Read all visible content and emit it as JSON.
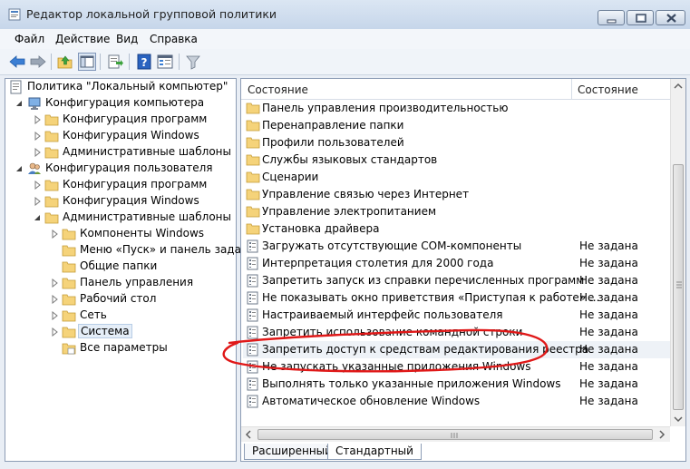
{
  "window": {
    "title": "Редактор локальной групповой политики"
  },
  "menu": [
    "Файл",
    "Действие",
    "Вид",
    "Справка"
  ],
  "toolbar": {
    "buttons": [
      "back-icon",
      "forward-icon",
      "up-folder-icon",
      "show-hide-tree-icon",
      "export-list-icon",
      "help-icon",
      "properties-icon",
      "filter-icon"
    ]
  },
  "tree": {
    "root": "Политика \"Локальный компьютер\"",
    "computer_config": "Конфигурация компьютера",
    "cc_programs": "Конфигурация программ",
    "cc_windows": "Конфигурация Windows",
    "cc_admin": "Административные шаблоны",
    "user_config": "Конфигурация пользователя",
    "uc_programs": "Конфигурация программ",
    "uc_windows": "Конфигурация Windows",
    "uc_admin": "Административные шаблоны",
    "win_components": "Компоненты Windows",
    "start_menu": "Меню «Пуск» и панель задач",
    "shared_folders": "Общие папки",
    "control_panel": "Панель управления",
    "desktop": "Рабочий стол",
    "network": "Сеть",
    "system": "Система",
    "all_settings": "Все параметры"
  },
  "list": {
    "col_name": "Состояние",
    "col_state": "Состояние",
    "rows": [
      {
        "name": "Панель управления производительностью",
        "state": ""
      },
      {
        "name": "Перенаправление папки",
        "state": ""
      },
      {
        "name": "Профили пользователей",
        "state": ""
      },
      {
        "name": "Службы языковых стандартов",
        "state": ""
      },
      {
        "name": "Сценарии",
        "state": ""
      },
      {
        "name": "Управление связью через Интернет",
        "state": ""
      },
      {
        "name": "Управление электропитанием",
        "state": ""
      },
      {
        "name": "Установка драйвера",
        "state": ""
      },
      {
        "name": "Загружать отсутствующие COM-компоненты",
        "state": "Не задана"
      },
      {
        "name": "Интерпретация столетия для 2000 года",
        "state": "Не задана"
      },
      {
        "name": "Запретить запуск из справки перечисленных программ",
        "state": "Не задана"
      },
      {
        "name": "Не показывать окно приветствия «Приступая к работе» ...",
        "state": "Не задана"
      },
      {
        "name": "Настраиваемый интерфейс пользователя",
        "state": "Не задана"
      },
      {
        "name": "Запретить использование командной строки",
        "state": "Не задана"
      },
      {
        "name": "Запретить доступ к средствам редактирования реестра",
        "state": "Не задана"
      },
      {
        "name": "Не запускать указанные приложения Windows",
        "state": "Не задана"
      },
      {
        "name": "Выполнять только указанные приложения Windows",
        "state": "Не задана"
      },
      {
        "name": "Автоматическое обновление Windows",
        "state": "Не задана"
      }
    ]
  },
  "tabs": [
    "Расширенный",
    "Стандартный"
  ],
  "colors": {
    "annotation": "#e01818",
    "folder": "#f5d37a",
    "selection": "#e5eef8"
  }
}
